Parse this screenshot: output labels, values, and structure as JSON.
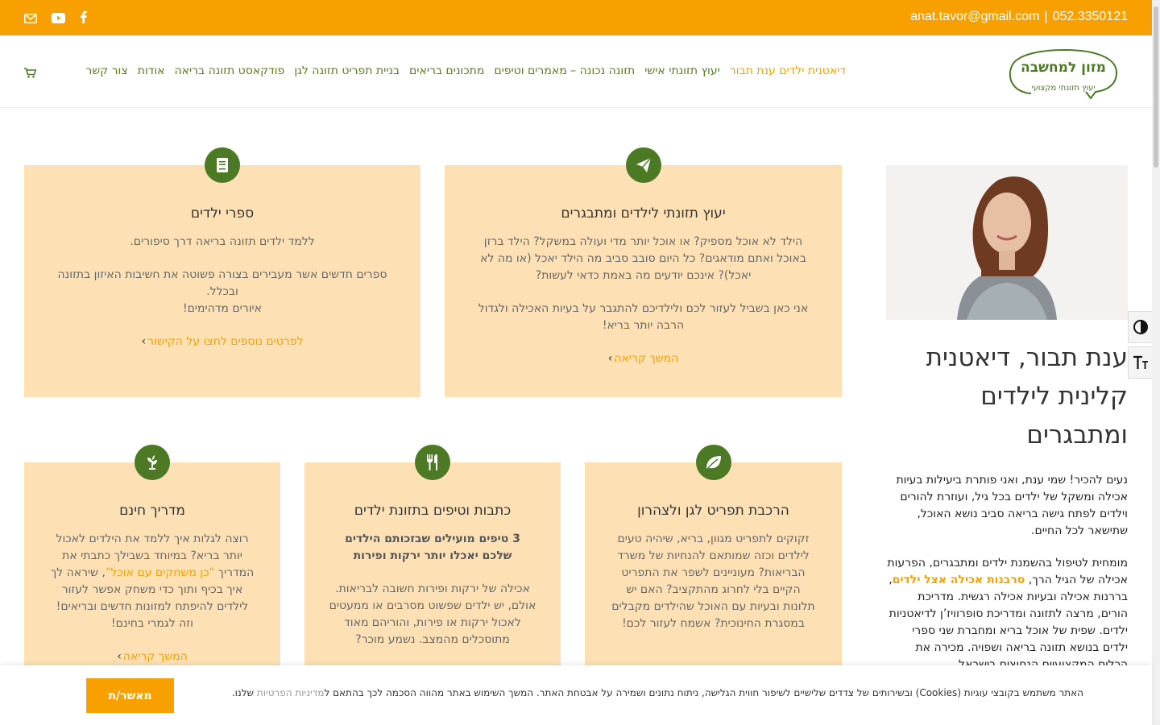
{
  "topbar": {
    "email": "anat.tavor@gmail.com",
    "separator": "|",
    "phone": "052.3350121"
  },
  "logo": {
    "title": "מזון למחשבה",
    "subtitle": "יעוץ תזונתי מקצועי"
  },
  "nav": {
    "items": [
      {
        "label": "דיאטנית ילדים ענת תבור",
        "active": true
      },
      {
        "label": "יעוץ תזונתי אישי"
      },
      {
        "label": "תזונה נכונה – מאמרים וטיפים"
      },
      {
        "label": "מתכונים בריאים"
      },
      {
        "label": "בניית תפריט תזונה לגן"
      },
      {
        "label": "פודקאסט תזונה בריאה"
      },
      {
        "label": "אודות"
      },
      {
        "label": "צור קשר"
      }
    ]
  },
  "profile": {
    "title": "ענת תבור, דיאטנית קלינית לילדים ומתבגרים",
    "para1": "נעים להכיר! שמי ענת, ואני פותרת ביעילות בעיות אכילה ומשקל של ילדים בכל גיל, ועוזרת להורים וילדים לפתח גישה בריאה סביב נושא האוכל, שתישאר לכל החיים.",
    "para2_a": "מומחית לטיפול בהשמנת ילדים ומתבגרים, הפרעות אכילה של הגיל הרך,",
    "para2_link": "סרבנות אכילה אצל ילדים",
    "para2_b": ", בררנות אכילה ובעיות אכילה רגשית. מדריכת הורים, מרצה לתזונה ומדריכת סופרוויז’ן לדיאטניות ילדים. שפית של אוכל בריא ומחברת שני ספרי ילדים בנושא תזונה בריאה ושפויה. מכירה את הכלים המקצועיים הנחוצים בישראל"
  },
  "cards": {
    "c1": {
      "title": "יעוץ תזונתי לילדים ומתבגרים",
      "p1": "הילד לא אוכל מספיק? או אוכל יותר מדי ועולה במשקל? הילד ברזן באוכל ואתם מודאגים? כל היום סובב סביב מה הילד יאכל (או מה לא יאכל)? אינכם יודעים מה באמת כדאי לעשות?",
      "p2": "אני כאן בשביל לעזור לכם ולילדיכם להתגבר על בעיות האכילה ולגדול הרבה יותר בריא!",
      "more": "המשך קריאה"
    },
    "c2": {
      "title": "ספרי ילדים",
      "p1": "ללמד ילדים תזונה בריאה דרך סיפורים.",
      "p2": "ספרים חדשים אשר מעבירים בצורה פשוטה את חשיבות האיזון בתזונה ובכלל.",
      "p3": "איורים מדהימים!",
      "more": "לפרטים נוספים לחצו על הקישור"
    },
    "c3": {
      "title": "הרכבת תפריט לגן ולצהרון",
      "p1": "זקוקים לתפריט מגוון, בריא, שיהיה טעים לילדים וכזה שמותאם להנחיות של משרד הבריאות? מעוניינים לשפר את התפריט הקיים בלי לחרוג מהתקציב? האם יש תלונות ובעיות עם האוכל שהילדים מקבלים במסגרת החינוכית? אשמח לעזור לכם!"
    },
    "c4": {
      "title": "כתבות וטיפים בתזונת ילדים",
      "bold": "3 טיפים מועילים שבזכותם הילדים שלכם יאכלו יותר ירקות ופירות",
      "p1": "אכילה של ירקות ופירות חשובה לבריאות. אולם, יש ילדים שפשוט מסרבים או ממעטים לאכול ירקות או פירות, והוריהם מאוד מתוסכלים מהמצב. נשמע מוכר?"
    },
    "c5": {
      "title": "מדריך חינם",
      "p1a": "רוצה לגלות איך ללמד את הילדים לאכול יותר בריא? במיוחד בשבילך כתבתי את המדריך",
      "p1link": "\"כן משחקים עם אוכל\"",
      "p1b": ", שיראה לך איך בכיף ותוך כדי משחק אפשר לעזור לילדים להיפתח למזונות חדשים ובריאים! וזה לגמרי בחינם!",
      "more": "המשך קריאה"
    }
  },
  "cookie": {
    "text": "האתר משתמש בקובצי עוגיות (Cookies) ובשירותים של צדדים שלישיים לשיפור חווית הגלישה, ניתוח נתונים ושמירה על אבטחת האתר. המשך השימוש באתר מהווה הסכמה לכך בהתאם ל",
    "policy_link": "מדיניות הפרטיות",
    "suffix": " שלנו.",
    "button": "מאשר/ת"
  },
  "colors": {
    "brand_orange": "#f7a000",
    "brand_green": "#4c7a24",
    "card_bg": "#fde1b4"
  }
}
